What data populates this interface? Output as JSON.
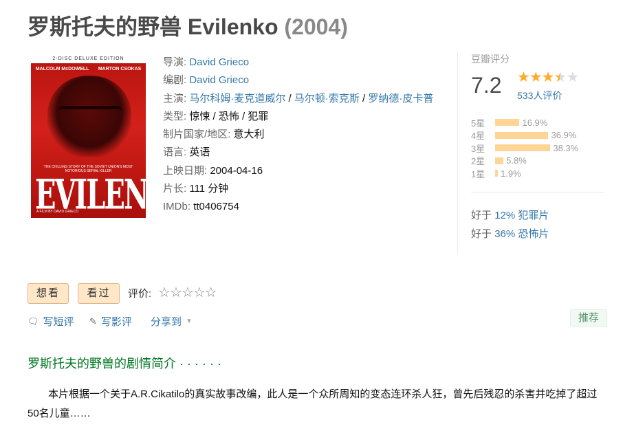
{
  "movie": {
    "title": "罗斯托夫的野兽 Evilenko",
    "year": "(2004)"
  },
  "poster": {
    "top_text": "2-DISC DELUXE EDITION",
    "cast_left": "MALCOLM McDOWELL",
    "cast_right": "MARTON CSOKAS",
    "tagline": "THE CHILLING STORY OF THE SOVIET UNION'S MOST NOTORIOUS SERIAL KILLER",
    "title": "EVILENKO",
    "footer": "A FILM BY DAVID GRIECO"
  },
  "info": {
    "director_label": "导演:",
    "director": "David Grieco",
    "writer_label": "编剧:",
    "writer": "David Grieco",
    "cast_label": "主演:",
    "cast": [
      "马尔科姆·麦克道威尔",
      "马尔顿·索克斯",
      "罗纳德·皮卡普"
    ],
    "cast_sep": " / ",
    "genre_label": "类型:",
    "genre": "惊悚 / 恐怖 / 犯罪",
    "country_label": "制片国家/地区:",
    "country": "意大利",
    "language_label": "语言:",
    "language": "英语",
    "release_label": "上映日期:",
    "release": "2004-04-16",
    "runtime_label": "片长:",
    "runtime": "111 分钟",
    "imdb_label": "IMDb:",
    "imdb": "tt0406754"
  },
  "rating": {
    "header": "豆瓣评分",
    "score": "7.2",
    "stars_filled": 3.5,
    "count": "533人评价",
    "distribution": [
      {
        "label": "5星",
        "pct": "16.9%",
        "value": 16.9
      },
      {
        "label": "4星",
        "pct": "36.9%",
        "value": 36.9
      },
      {
        "label": "3星",
        "pct": "38.3%",
        "value": 38.3
      },
      {
        "label": "2星",
        "pct": "5.8%",
        "value": 5.8
      },
      {
        "label": "1星",
        "pct": "1.9%",
        "value": 1.9
      }
    ],
    "better_than": [
      {
        "prefix": "好于",
        "text": "12% 犯罪片"
      },
      {
        "prefix": "好于",
        "text": "36% 恐怖片"
      }
    ]
  },
  "actions": {
    "want": "想看",
    "seen": "看过",
    "rate_label": "评价:",
    "short_review": "写短评",
    "review": "写影评",
    "share": "分享到",
    "recommend": "推荐"
  },
  "synopsis": {
    "heading": "罗斯托夫的野兽的剧情简介 · · · · · ·",
    "text": "本片根据一个关于A.R.Cikatilo的真实故事改编，此人是一个众所周知的变态连环杀人狂，曾先后残忍的杀害并吃掉了超过50名儿童……"
  },
  "colors": {
    "link": "#3377aa",
    "green": "#007722",
    "star": "#ffac2d",
    "bar": "#ffd596"
  }
}
